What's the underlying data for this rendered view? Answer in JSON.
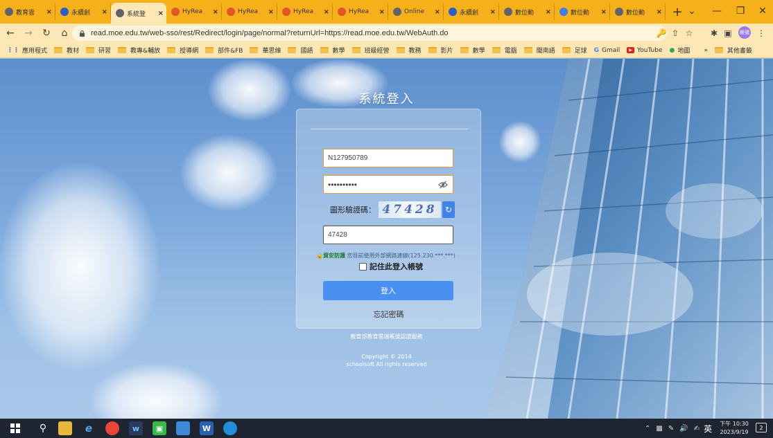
{
  "browser": {
    "tabs": [
      {
        "title": "教育雲",
        "icon": "globe-icon",
        "active": false
      },
      {
        "title": "永續創",
        "icon": "blue-diamond-icon",
        "active": false
      },
      {
        "title": "系統登",
        "icon": "globe-icon",
        "active": true
      },
      {
        "title": "HyRea",
        "icon": "hyread-icon",
        "active": false
      },
      {
        "title": "HyRea",
        "icon": "hyread-icon",
        "active": false
      },
      {
        "title": "HyRea",
        "icon": "hyread-icon",
        "active": false
      },
      {
        "title": "HyRea",
        "icon": "hyread-icon",
        "active": false
      },
      {
        "title": "Online",
        "icon": "globe-icon",
        "active": false
      },
      {
        "title": "永續創",
        "icon": "blue-diamond-icon",
        "active": false
      },
      {
        "title": "數位動",
        "icon": "globe-icon",
        "active": false
      },
      {
        "title": "數位動",
        "icon": "globe-blue-icon",
        "active": false
      },
      {
        "title": "數位動",
        "icon": "globe-icon",
        "active": false
      }
    ],
    "new_tab": "+",
    "url": "read.moe.edu.tw/web-sso/rest/Redirect/login/page/normal?returnUrl=https://read.moe.edu.tw/WebAuth.do",
    "profile_label": "帳號",
    "bookmarks": [
      {
        "label": "應用程式",
        "type": "apps"
      },
      {
        "label": "教材",
        "type": "folder"
      },
      {
        "label": "研習",
        "type": "folder"
      },
      {
        "label": "教專&輔放",
        "type": "folder"
      },
      {
        "label": "授導網",
        "type": "folder"
      },
      {
        "label": "部件&FB",
        "type": "folder"
      },
      {
        "label": "華思維",
        "type": "folder"
      },
      {
        "label": "國語",
        "type": "folder"
      },
      {
        "label": "數學",
        "type": "folder"
      },
      {
        "label": "班級經營",
        "type": "folder"
      },
      {
        "label": "教務",
        "type": "folder"
      },
      {
        "label": "影片",
        "type": "folder"
      },
      {
        "label": "數學",
        "type": "folder"
      },
      {
        "label": "電腦",
        "type": "folder"
      },
      {
        "label": "閩南語",
        "type": "folder"
      },
      {
        "label": "足球",
        "type": "folder"
      },
      {
        "label": "Gmail",
        "type": "gmail"
      },
      {
        "label": "YouTube",
        "type": "youtube"
      },
      {
        "label": "地圖",
        "type": "maps"
      }
    ],
    "bookmarks_more": "»",
    "other_bookmarks": "其他書籤"
  },
  "login": {
    "title": "系統登入",
    "username": "N127950789",
    "password_mask": "••••••••••",
    "captcha_label": "圖形驗證碼：",
    "captcha_image_text": "47428",
    "captcha_input": "47428",
    "secure_label": "資安防護",
    "notice": "您目前使用外部網路連線(125.230.***.***)",
    "remember_label": "記住此登入帳號",
    "login_button": "登入",
    "forgot_link": "忘記密碼",
    "service_name": "教育部教育雲端帳號認證服務",
    "copyright_line1": "Copyright © 2014",
    "copyright_line2": "schoolsoft All rights reserved"
  },
  "taskbar": {
    "ime": "英",
    "time": "下午 10:30",
    "date": "2023/9/19",
    "notification_count": "2"
  },
  "colors": {
    "chrome_frame": "#f6b01a",
    "chrome_toolbar": "#fde7b4",
    "login_button": "#4a90f2",
    "input_border": "#e69a3a"
  }
}
